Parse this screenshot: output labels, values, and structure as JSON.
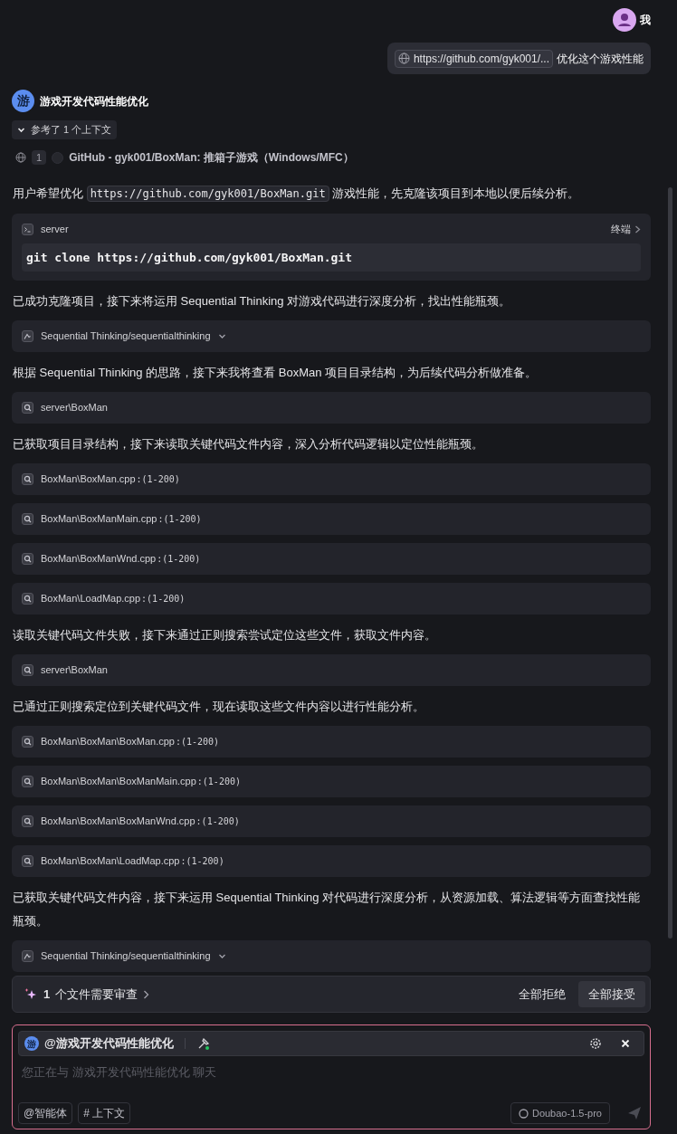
{
  "user": {
    "name": "我",
    "link": "https://github.com/gyk001/...",
    "message": "优化这个游戏性能"
  },
  "agent": {
    "avatar": "游",
    "name": "游戏开发代码性能优化"
  },
  "references": {
    "label": "参考了 1 个上下文",
    "expanded": true,
    "items": [
      {
        "index": "1",
        "title": "GitHub - gyk001/BoxMan: 推箱子游戏（Windows/MFC）"
      }
    ]
  },
  "feed": [
    {
      "kind": "text",
      "segments": [
        {
          "text": "用户希望优化 ",
          "code": false
        },
        {
          "text": "https://github.com/gyk001/BoxMan.git",
          "code": true
        },
        {
          "text": " 游戏性能，先克隆该项目到本地以便后续分析。",
          "code": false
        }
      ]
    },
    {
      "kind": "terminal",
      "label": "server",
      "action": "终端",
      "command": "git clone https://github.com/gyk001/BoxMan.git"
    },
    {
      "kind": "text",
      "segments": [
        {
          "text": "已成功克隆项目，接下来将运用 Sequential Thinking 对游戏代码进行深度分析，找出性能瓶颈。",
          "code": false
        }
      ]
    },
    {
      "kind": "mcp",
      "label": "Sequential Thinking/sequentialthinking"
    },
    {
      "kind": "text",
      "segments": [
        {
          "text": "根据 Sequential Thinking 的思路，接下来我将查看 BoxMan 项目目录结构，为后续代码分析做准备。",
          "code": false
        }
      ]
    },
    {
      "kind": "search",
      "label": "server\\BoxMan"
    },
    {
      "kind": "text",
      "segments": [
        {
          "text": "已获取项目目录结构，接下来读取关键代码文件内容，深入分析代码逻辑以定位性能瓶颈。",
          "code": false
        }
      ]
    },
    {
      "kind": "read",
      "label": "BoxMan\\BoxMan.cpp",
      "range": ":(1-200)"
    },
    {
      "kind": "read",
      "label": "BoxMan\\BoxManMain.cpp",
      "range": ":(1-200)"
    },
    {
      "kind": "read",
      "label": "BoxMan\\BoxManWnd.cpp",
      "range": ":(1-200)"
    },
    {
      "kind": "read",
      "label": "BoxMan\\LoadMap.cpp",
      "range": ":(1-200)"
    },
    {
      "kind": "text",
      "segments": [
        {
          "text": "读取关键代码文件失败，接下来通过正则搜索尝试定位这些文件，获取文件内容。",
          "code": false
        }
      ]
    },
    {
      "kind": "search",
      "label": "server\\BoxMan"
    },
    {
      "kind": "text",
      "segments": [
        {
          "text": "已通过正则搜索定位到关键代码文件，现在读取这些文件内容以进行性能分析。",
          "code": false
        }
      ]
    },
    {
      "kind": "read",
      "label": "BoxMan\\BoxMan\\BoxMan.cpp",
      "range": ":(1-200)"
    },
    {
      "kind": "read",
      "label": "BoxMan\\BoxMan\\BoxManMain.cpp",
      "range": ":(1-200)"
    },
    {
      "kind": "read",
      "label": "BoxMan\\BoxMan\\BoxManWnd.cpp",
      "range": ":(1-200)"
    },
    {
      "kind": "read",
      "label": "BoxMan\\BoxMan\\LoadMap.cpp",
      "range": ":(1-200)"
    },
    {
      "kind": "text",
      "segments": [
        {
          "text": "已获取关键代码文件内容，接下来运用 Sequential Thinking 对代码进行深度分析，从资源加载、算法逻辑等方面查找性能瓶颈。",
          "code": false
        }
      ]
    },
    {
      "kind": "mcp",
      "label": "Sequential Thinking/sequentialthinking"
    }
  ],
  "review": {
    "count": "1",
    "label": "个文件需要审查",
    "reject": "全部拒绝",
    "accept": "全部接受"
  },
  "composer": {
    "agent_avatar": "游",
    "agent": "@游戏开发代码性能优化",
    "placeholder": "您正在与 游戏开发代码性能优化 聊天",
    "chips": [
      "@智能体",
      "# 上下文"
    ],
    "model": "Doubao-1.5-pro"
  }
}
